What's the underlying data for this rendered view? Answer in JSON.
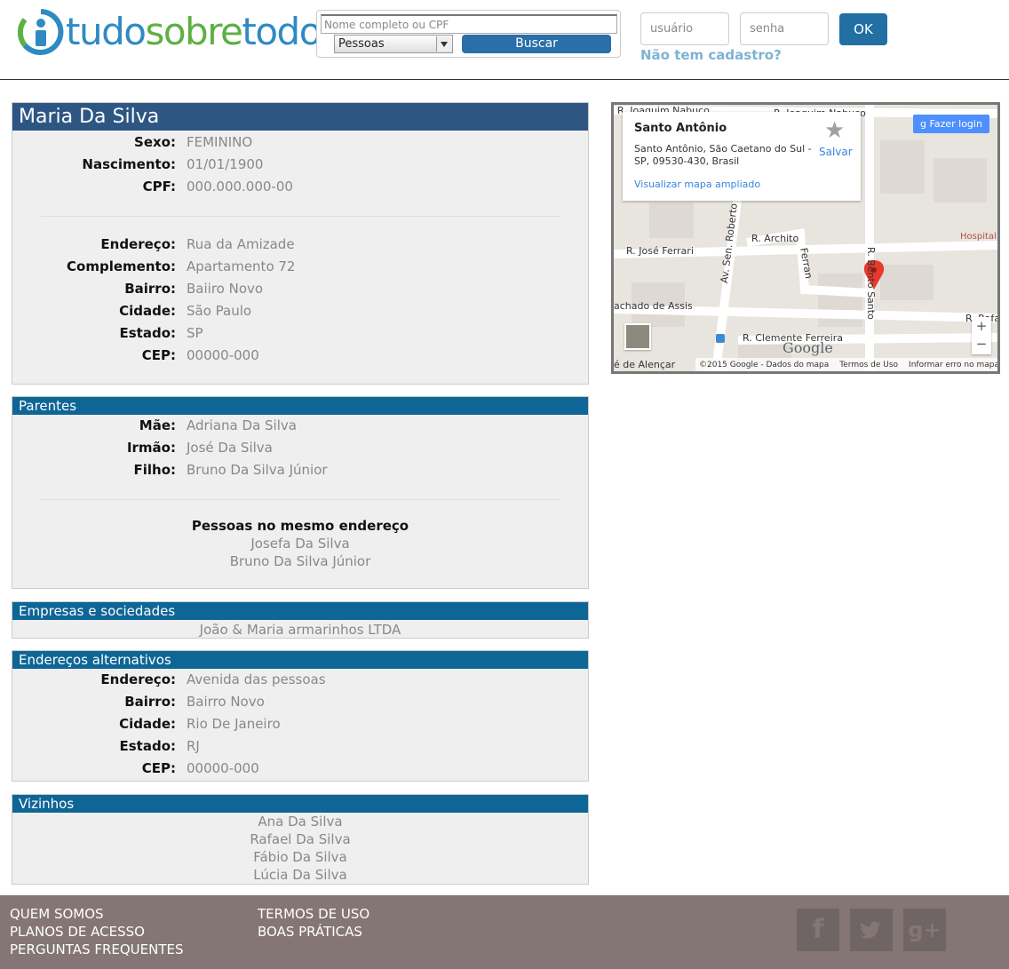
{
  "header": {
    "logo": {
      "part1": "tudo",
      "part2": "sobre",
      "part3": "todos"
    },
    "search_placeholder": "Nome completo ou CPF",
    "search_type": "Pessoas",
    "search_button": "Buscar",
    "user_placeholder": "usuário",
    "pass_placeholder": "senha",
    "ok_button": "OK",
    "signup_link": "Não tem cadastro?"
  },
  "person": {
    "name": "Maria Da Silva",
    "basic": [
      {
        "label": "Sexo:",
        "value": "FEMININO"
      },
      {
        "label": "Nascimento:",
        "value": "01/01/1900"
      },
      {
        "label": "CPF:",
        "value": "000.000.000-00"
      }
    ],
    "address": [
      {
        "label": "Endereço:",
        "value": "Rua da Amizade"
      },
      {
        "label": "Complemento:",
        "value": "Apartamento 72"
      },
      {
        "label": "Bairro:",
        "value": "Baiiro Novo"
      },
      {
        "label": "Cidade:",
        "value": "São Paulo"
      },
      {
        "label": "Estado:",
        "value": "SP"
      },
      {
        "label": "CEP:",
        "value": "00000-000"
      }
    ]
  },
  "relatives": {
    "title": "Parentes",
    "rows": [
      {
        "label": "Mãe:",
        "value": "Adriana Da Silva"
      },
      {
        "label": "Irmão:",
        "value": "José Da Silva"
      },
      {
        "label": "Filho:",
        "value": "Bruno Da Silva Júnior"
      }
    ],
    "same_address_heading": "Pessoas no mesmo endereço",
    "same_address": [
      "Josefa Da Silva",
      "Bruno Da Silva Júnior"
    ]
  },
  "companies": {
    "title": "Empresas e sociedades",
    "items": [
      "João & Maria armarinhos LTDA"
    ]
  },
  "alt_addresses": {
    "title": "Endereços alternativos",
    "rows": [
      {
        "label": "Endereço:",
        "value": "Avenida das pessoas"
      },
      {
        "label": "Bairro:",
        "value": "Bairro Novo"
      },
      {
        "label": "Cidade:",
        "value": "Rio De Janeiro"
      },
      {
        "label": "Estado:",
        "value": "RJ"
      },
      {
        "label": "CEP:",
        "value": "00000-000"
      }
    ]
  },
  "neighbors": {
    "title": "Vizinhos",
    "items": [
      "Ana Da Silva",
      "Rafael Da Silva",
      "Fábio Da Silva",
      "Lúcia Da Silva"
    ]
  },
  "map": {
    "place": "Santo Antônio",
    "address": "Santo Antônio, São Caetano do Sul - SP, 09530-430, Brasil",
    "view_larger": "Visualizar mapa ampliado",
    "save": "Salvar",
    "login": "Fazer login",
    "streets": [
      "R. Joaquim Nabuco",
      "R. Joaquim Nabuco",
      "R. Archito",
      "R. José Ferrari",
      "Av. Sen. Roberto S",
      "Ferran",
      "R. Bento Santo",
      "achado de Assis",
      "R. Clemente Ferreira",
      "R. Rafa",
      "é de Alençar"
    ],
    "hospital": "Hospital",
    "google": "Google",
    "footer": [
      "©2015 Google - Dados do mapa",
      "Termos de Uso",
      "Informar erro no mapa"
    ],
    "zoom_in": "+",
    "zoom_out": "−"
  },
  "footer": {
    "links_left": [
      "QUEM SOMOS",
      "PLANOS DE ACESSO",
      "PERGUNTAS FREQUENTES"
    ],
    "links_right": [
      "TERMOS DE USO",
      "BOAS PRÁTICAS"
    ],
    "social": [
      "f",
      "twitter",
      "g+"
    ]
  },
  "colors": {
    "header_blue": "#2d5683",
    "section_blue": "#0e6696",
    "footer_bg": "#847674"
  }
}
